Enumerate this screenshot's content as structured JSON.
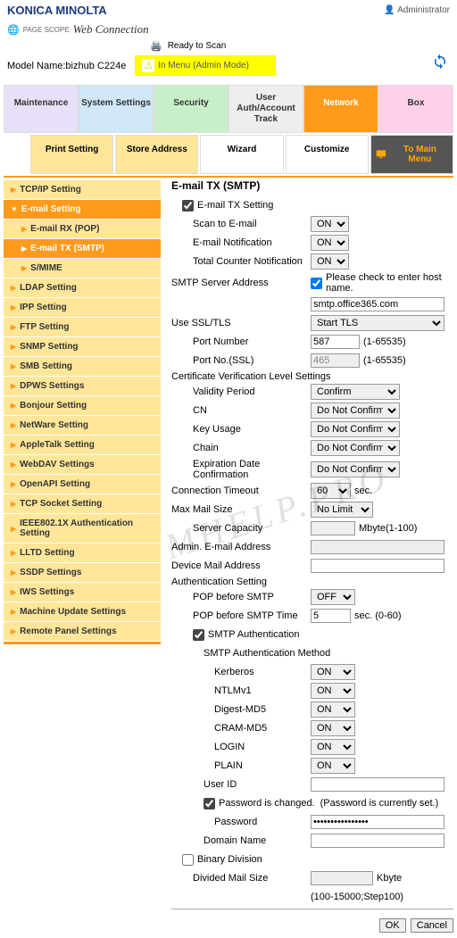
{
  "brand": "KONICA MINOLTA",
  "admin_label": "Administrator",
  "web_connection": "Web Connection",
  "page_scope": "PAGE SCOPE",
  "ready_status": "Ready to Scan",
  "model_label": "Model Name:",
  "model_value": "bizhub C224e",
  "mode_text": "In Menu (Admin Mode)",
  "main_tabs": {
    "maintenance": "Maintenance",
    "system": "System Settings",
    "security": "Security",
    "user": "User Auth/Account Track",
    "network": "Network",
    "box": "Box"
  },
  "sub_tabs": {
    "print": "Print Setting",
    "store": "Store Address",
    "wizard": "Wizard",
    "customize": "Customize",
    "to_main": "To Main Menu"
  },
  "sidebar": {
    "tcp": "TCP/IP Setting",
    "email": "E-mail Setting",
    "email_rx": "E-mail RX (POP)",
    "email_tx": "E-mail TX (SMTP)",
    "smime": "S/MIME",
    "ldap": "LDAP Setting",
    "ipp": "IPP Setting",
    "ftp": "FTP Setting",
    "snmp": "SNMP Setting",
    "smb": "SMB Setting",
    "dpws": "DPWS Settings",
    "bonjour": "Bonjour Setting",
    "netware": "NetWare Setting",
    "appletalk": "AppleTalk Setting",
    "webdav": "WebDAV Settings",
    "openapi": "OpenAPI Setting",
    "tcpsocket": "TCP Socket Setting",
    "ieee": "IEEE802.1X Authentication Setting",
    "lltd": "LLTD Setting",
    "ssdp": "SSDP Settings",
    "iws": "IWS Settings",
    "machine": "Machine Update Settings",
    "remote": "Remote Panel Settings"
  },
  "form": {
    "title": "E-mail TX (SMTP)",
    "email_tx_setting": "E-mail TX Setting",
    "scan_to_email": "Scan to E-mail",
    "email_notification": "E-mail Notification",
    "total_counter": "Total Counter Notification",
    "smtp_server": "SMTP Server Address",
    "host_check": "Please check to enter host name.",
    "smtp_server_value": "smtp.office365.com",
    "use_ssl": "Use SSL/TLS",
    "ssl_value": "Start TLS",
    "port_number": "Port Number",
    "port_number_value": "587",
    "port_range": "(1-65535)",
    "port_ssl": "Port No.(SSL)",
    "port_ssl_value": "465",
    "cert_section": "Certificate Verification Level Settings",
    "validity": "Validity Period",
    "validity_value": "Confirm",
    "cn": "CN",
    "cn_value": "Do Not Confirm",
    "key_usage": "Key Usage",
    "chain": "Chain",
    "expiration": "Expiration Date Confirmation",
    "conn_timeout": "Connection Timeout",
    "conn_timeout_value": "60",
    "sec": "sec.",
    "max_mail": "Max Mail Size",
    "max_mail_value": "No Limit",
    "server_cap": "Server Capacity",
    "mbyte_range": "Mbyte(1-100)",
    "admin_email": "Admin. E-mail Address",
    "device_email": "Device Mail Address",
    "auth_section": "Authentication Setting",
    "pop_before": "POP before SMTP",
    "pop_before_value": "OFF",
    "pop_time": "POP before SMTP Time",
    "pop_time_value": "5",
    "pop_time_range": "sec. (0-60)",
    "smtp_auth": "SMTP Authentication",
    "smtp_method": "SMTP Authentication Method",
    "kerberos": "Kerberos",
    "ntlm": "NTLMv1",
    "digest": "Digest-MD5",
    "cram": "CRAM-MD5",
    "login": "LOGIN",
    "plain": "PLAIN",
    "on": "ON",
    "user_id": "User ID",
    "pwd_changed": "Password is changed.",
    "pwd_set": "(Password is currently set.)",
    "password": "Password",
    "password_value": "••••••••••••••••",
    "domain": "Domain Name",
    "binary_div": "Binary Division",
    "divided_size": "Divided Mail Size",
    "kbyte": "Kbyte",
    "size_range": "(100-15000;Step100)"
  },
  "buttons": {
    "ok": "OK",
    "cancel": "Cancel"
  },
  "watermark": "MHELP.PRO"
}
